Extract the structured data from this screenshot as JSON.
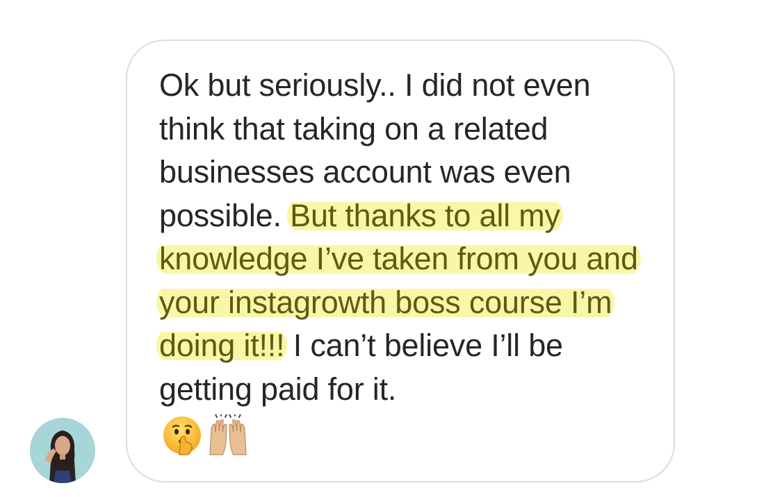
{
  "message": {
    "text_before": "Ok but seriously.. I did not even think that taking on a related businesses account was even possible.",
    "text_highlighted": "But thanks to all my knowledge I’ve taken from you and your instagrowth boss course I’m doing it!!!",
    "text_after": "I can’t believe I’ll be getting paid for it.",
    "emojis": [
      "shushing-face-icon",
      "raising-hands-icon"
    ]
  },
  "colors": {
    "bubble_border": "#dcdcdc",
    "text": "#262626",
    "highlight": "#f8f7a6",
    "highlight_text": "#5e5a13"
  }
}
